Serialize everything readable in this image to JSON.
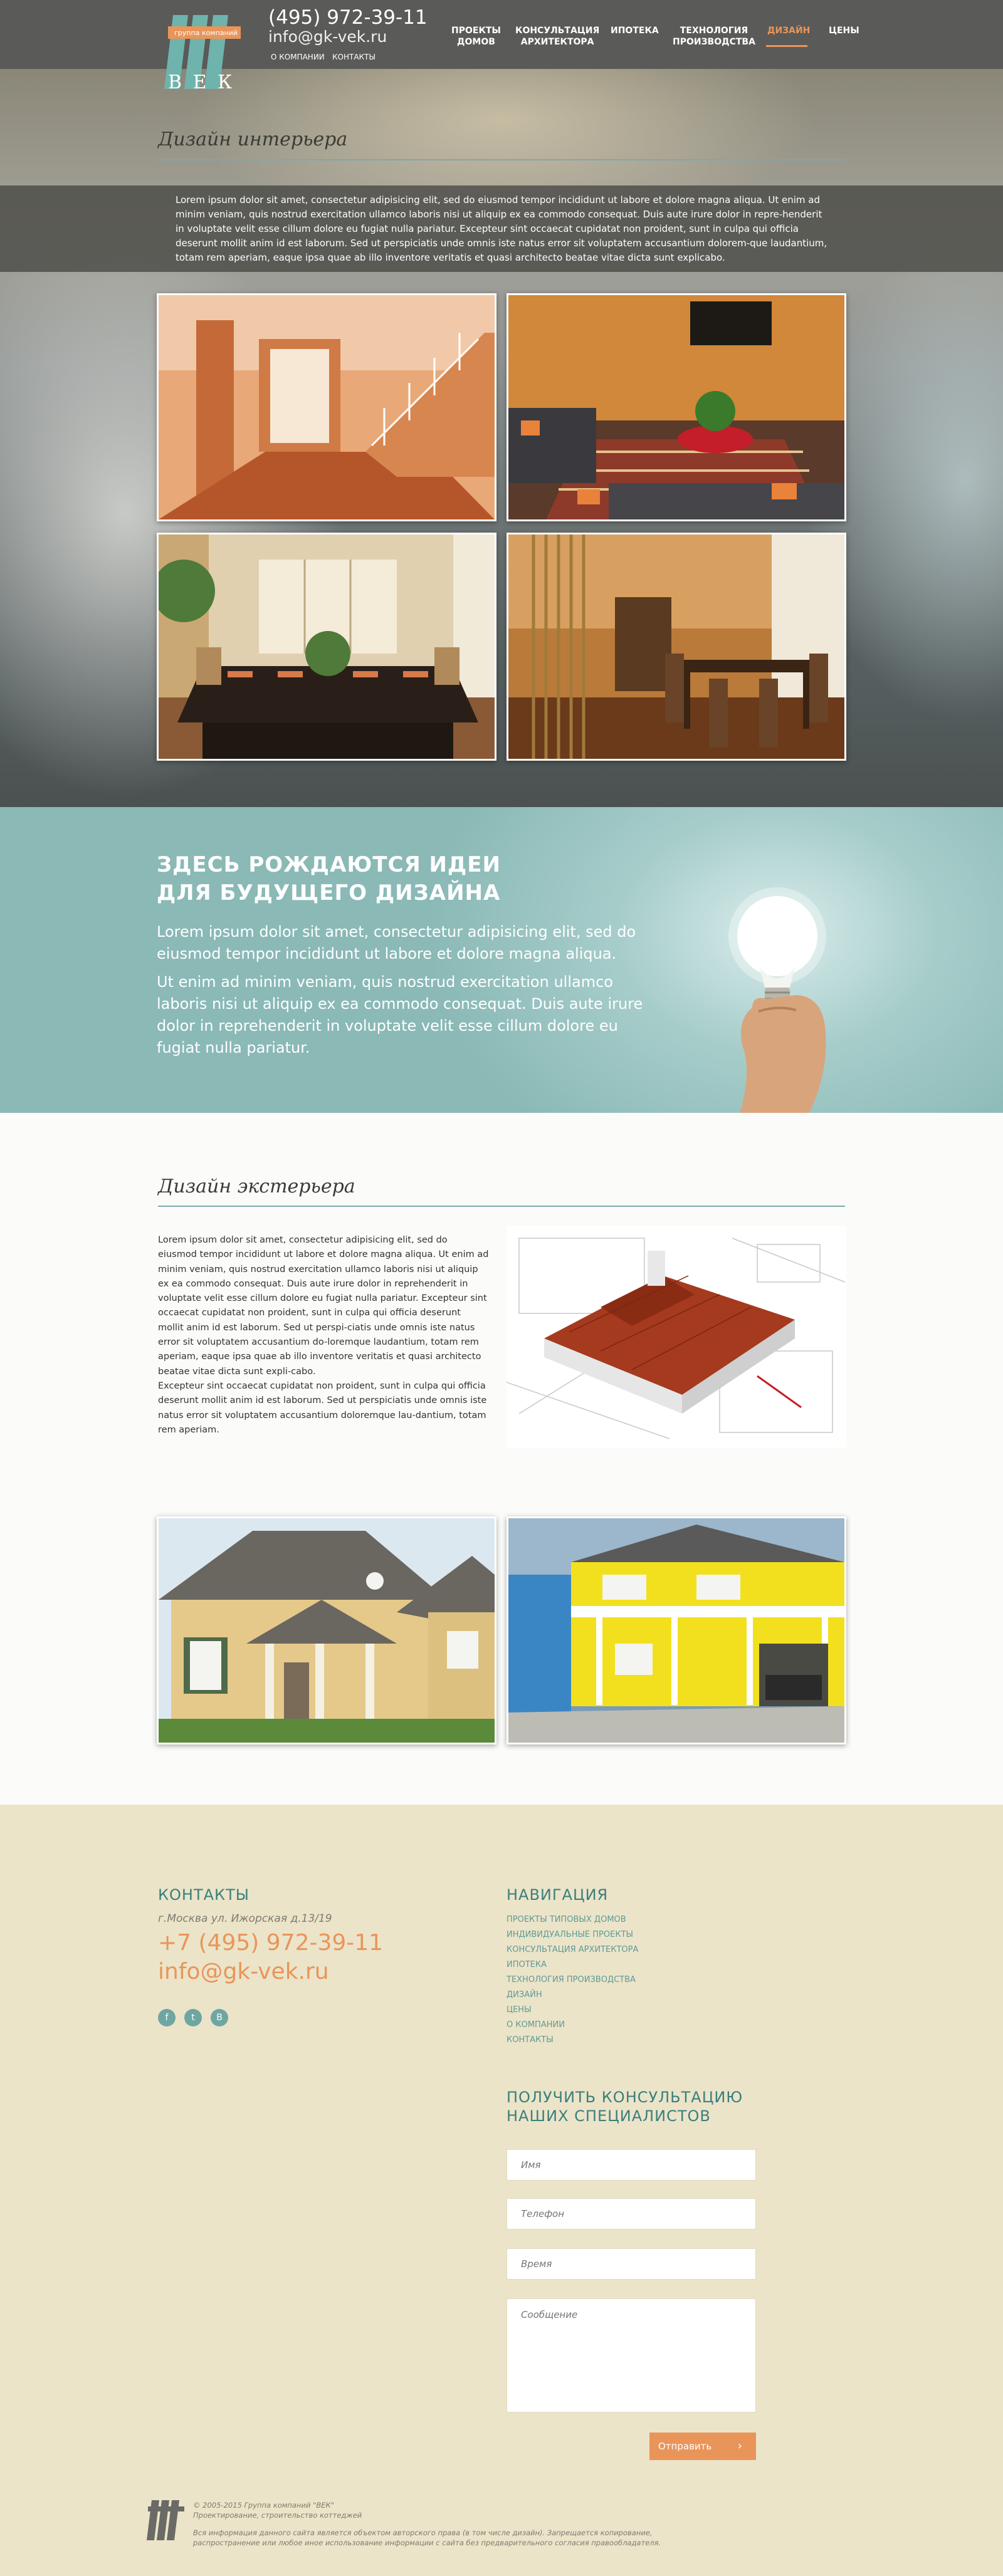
{
  "header": {
    "logo_tagline": "группа компаний",
    "logo_letters": "В Е К",
    "phone": "(495) 972-39-11",
    "email": "info@gk-vek.ru",
    "subnav": [
      "О КОМПАНИИ",
      "КОНТАКТЫ"
    ],
    "nav": [
      {
        "line1": "ПРОЕКТЫ",
        "line2": "ДОМОВ"
      },
      {
        "line1": "КОНСУЛЬТАЦИЯ",
        "line2": "АРХИТЕКТОРА"
      },
      {
        "line1": "ИПОТЕКА",
        "line2": ""
      },
      {
        "line1": "ТЕХНОЛОГИЯ",
        "line2": "ПРОИЗВОДСТВА"
      },
      {
        "line1": "ДИЗАЙН",
        "line2": ""
      },
      {
        "line1": "ЦЕНЫ",
        "line2": ""
      }
    ],
    "active_nav": "ДИЗАЙН"
  },
  "interior": {
    "title": "Дизайн интерьера",
    "text": "Lorem ipsum dolor sit amet, consectetur adipisicing elit, sed do eiusmod tempor incididunt ut labore et dolore magna aliqua. Ut enim ad minim veniam, quis nostrud exercitation ullamco laboris nisi ut aliquip ex ea commodo consequat. Duis aute irure dolor in repre-henderit in voluptate velit esse cillum dolore eu fugiat nulla pariatur. Excepteur sint occaecat cupidatat non proident, sunt in culpa qui officia deserunt mollit anim id est laborum. Sed ut perspiciatis unde omnis iste natus error sit voluptatem accusantium dolorem-que laudantium, totam rem aperiam, eaque ipsa quae ab illo inventore veritatis et quasi architecto beatae vitae dicta sunt explicabo."
  },
  "ideas": {
    "heading_line1": "ЗДЕСЬ РОЖДАЮТСЯ ИДЕИ",
    "heading_line2": "ДЛЯ БУДУЩЕГО ДИЗАЙНА",
    "p1": "Lorem ipsum dolor sit amet, consectetur adipisicing elit, sed do eiusmod tempor incididunt ut labore et dolore magna aliqua.",
    "p2": "Ut enim ad minim veniam, quis nostrud exercitation ullamco laboris nisi ut aliquip ex ea commodo consequat. Duis aute irure dolor in reprehenderit in voluptate velit esse cillum dolore eu fugiat nulla pariatur."
  },
  "exterior": {
    "title": "Дизайн экстерьера",
    "p1": "Lorem ipsum dolor sit amet, consectetur adipisicing elit, sed do eiusmod tempor incididunt ut labore et dolore magna aliqua. Ut enim ad minim veniam, quis nostrud exercitation ullamco laboris nisi ut aliquip ex ea commodo consequat. Duis aute irure dolor in reprehenderit in voluptate velit esse cillum dolore eu fugiat nulla pariatur. Excepteur sint occaecat cupidatat non proident, sunt in culpa qui officia deserunt mollit anim id est laborum. Sed ut perspi-ciatis unde omnis iste natus error sit voluptatem accusantium do-loremque laudantium, totam rem aperiam, eaque ipsa quae ab illo inventore veritatis et quasi architecto beatae vitae dicta sunt expli-cabo.",
    "p2": "Excepteur sint occaecat cupidatat non proident, sunt in culpa qui officia deserunt mollit anim id est laborum. Sed ut perspiciatis unde omnis iste natus error sit voluptatem accusantium doloremque lau-dantium, totam rem aperiam."
  },
  "footer": {
    "contacts_title": "КОНТАКТЫ",
    "address": "г.Москва ул. Ижорская д.13/19",
    "phone": "+7 (495) 972-39-11",
    "email": "info@gk-vek.ru",
    "social": [
      "f",
      "t",
      "B"
    ],
    "nav_title": "НАВИГАЦИЯ",
    "nav_items": [
      "ПРОЕКТЫ ТИПОВЫХ ДОМОВ",
      "ИНДИВИДУАЛЬНЫЕ ПРОЕКТЫ",
      "КОНСУЛЬТАЦИЯ АРХИТЕКТОРА",
      "ИПОТЕКА",
      "ТЕХНОЛОГИЯ ПРОИЗВОДСТВА",
      "ДИЗАЙН",
      "ЦЕНЫ",
      "О КОМПАНИИ",
      "КОНТАКТЫ"
    ],
    "form_title_line1": "ПОЛУЧИТЬ КОНСУЛЬТАЦИЮ",
    "form_title_line2": "НАШИХ СПЕЦИАЛИСТОВ",
    "form": {
      "name_placeholder": "Имя",
      "phone_placeholder": "Телефон",
      "time_placeholder": "Время",
      "message_placeholder": "Сообщение",
      "submit_label": "Отправить"
    },
    "copyright_line1": "© 2005-2015 Группа компаний \"ВЕК\"",
    "copyright_line2": "Проектирование, строительство коттеджей",
    "disclaimer_line1": "Вся информация данного сайта является объектом авторского права (в том числе дизайн). Запрещается копирование,",
    "disclaimer_line2": "распространение или любое иное использование информации с сайта без предварительного согласия правообладателя."
  },
  "colors": {
    "accent_orange": "#e9955a",
    "teal": "#3a7f7c",
    "header_bg": "#5a5a58",
    "footer_bg": "#ebe4c9"
  }
}
